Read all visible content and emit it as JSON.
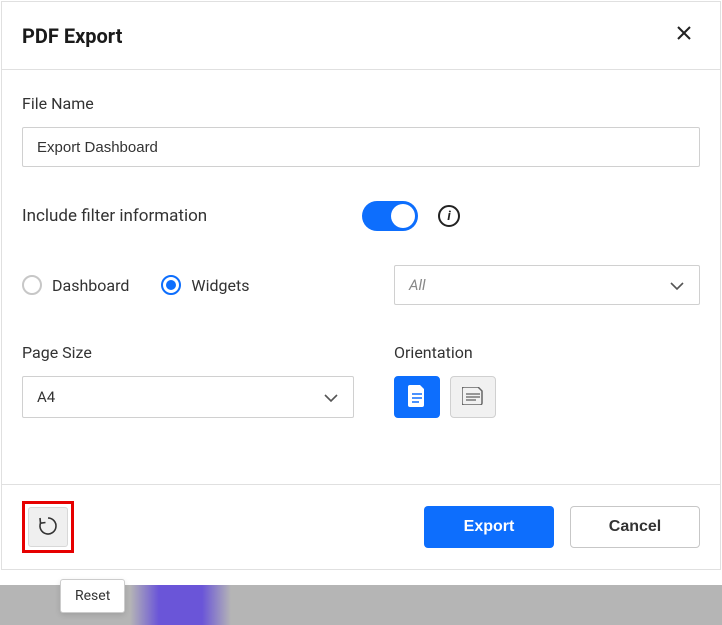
{
  "header": {
    "title": "PDF Export"
  },
  "fileName": {
    "label": "File Name",
    "value": "Export Dashboard"
  },
  "includeFilter": {
    "label": "Include filter information",
    "enabled": true
  },
  "exportType": {
    "options": [
      "Dashboard",
      "Widgets"
    ],
    "selected": "Widgets"
  },
  "widgetSelect": {
    "value": "All"
  },
  "pageSize": {
    "label": "Page Size",
    "value": "A4"
  },
  "orientation": {
    "label": "Orientation",
    "selected": "portrait"
  },
  "footer": {
    "resetTooltip": "Reset",
    "export": "Export",
    "cancel": "Cancel"
  }
}
